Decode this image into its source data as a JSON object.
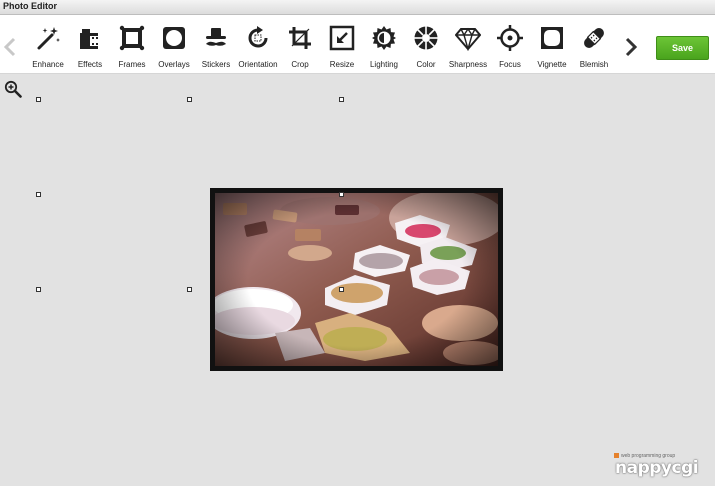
{
  "window": {
    "title": "Photo Editor"
  },
  "toolbar": {
    "tools": [
      {
        "id": "enhance",
        "label": "Enhance",
        "icon": "magic-wand-icon"
      },
      {
        "id": "effects",
        "label": "Effects",
        "icon": "film-icon"
      },
      {
        "id": "frames",
        "label": "Frames",
        "icon": "frame-icon"
      },
      {
        "id": "overlays",
        "label": "Overlays",
        "icon": "overlay-icon"
      },
      {
        "id": "stickers",
        "label": "Stickers",
        "icon": "mustache-hat-icon"
      },
      {
        "id": "orientation",
        "label": "Orientation",
        "icon": "rotate-icon"
      },
      {
        "id": "crop",
        "label": "Crop",
        "icon": "crop-icon"
      },
      {
        "id": "resize",
        "label": "Resize",
        "icon": "resize-icon"
      },
      {
        "id": "lighting",
        "label": "Lighting",
        "icon": "sun-icon"
      },
      {
        "id": "color",
        "label": "Color",
        "icon": "color-wheel-icon"
      },
      {
        "id": "sharpness",
        "label": "Sharpness",
        "icon": "diamond-icon"
      },
      {
        "id": "focus",
        "label": "Focus",
        "icon": "crosshair-icon"
      },
      {
        "id": "vignette",
        "label": "Vignette",
        "icon": "vignette-icon"
      },
      {
        "id": "blemish",
        "label": "Blemish",
        "icon": "bandage-icon"
      }
    ],
    "save_label": "Save",
    "prev_icon": "chevron-left-icon",
    "next_icon": "chevron-right-icon"
  },
  "canvas": {
    "zoom_icon": "zoom-in-icon"
  },
  "watermark": {
    "tagline": "web programming group",
    "brand": "nappycgi"
  },
  "colors": {
    "save": "#55b025",
    "background": "#e2e2e2",
    "toolbar": "#ffffff"
  }
}
